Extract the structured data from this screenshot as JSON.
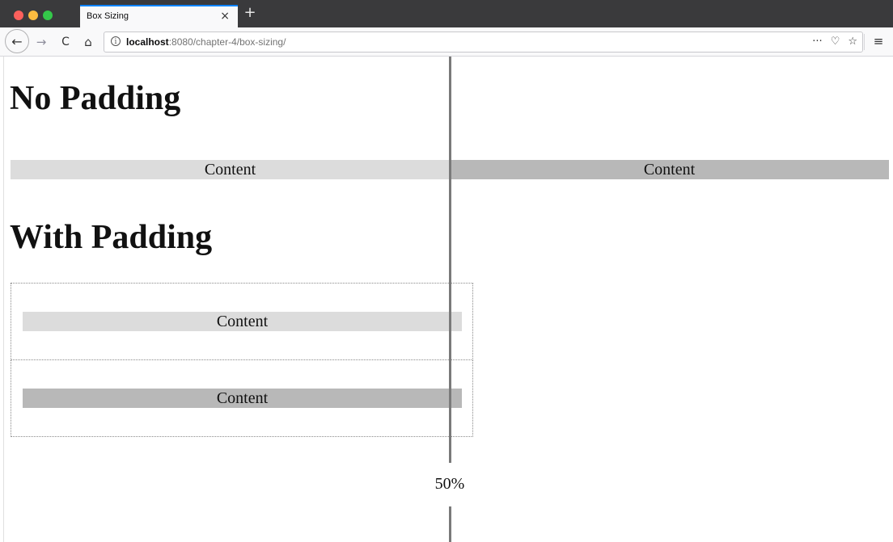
{
  "browser": {
    "tab_title": "Box Sizing",
    "tab_close": "×",
    "new_tab": "+",
    "url_host": "localhost",
    "url_rest": ":8080/chapter-4/box-sizing/",
    "nav": {
      "back": "←",
      "forward": "→",
      "reload": "C",
      "home": "⌂"
    },
    "url_actions": {
      "more": "···",
      "pocket": "♡",
      "bookmark": "☆"
    },
    "menu": "≡",
    "info": "i"
  },
  "page": {
    "heading_no_padding": "No Padding",
    "heading_with_padding": "With Padding",
    "no_padding_bars": [
      {
        "label": "Content"
      },
      {
        "label": "Content"
      }
    ],
    "with_padding_bars": [
      {
        "label": "Content"
      },
      {
        "label": "Content"
      }
    ],
    "midline_label": "50%"
  },
  "colors": {
    "titlebar": "#3a3a3c",
    "tab_accent": "#0a84ff",
    "bar_light": "#dcdcdc",
    "bar_dark": "#b8b8b8",
    "midline": "#7a7a7a"
  }
}
